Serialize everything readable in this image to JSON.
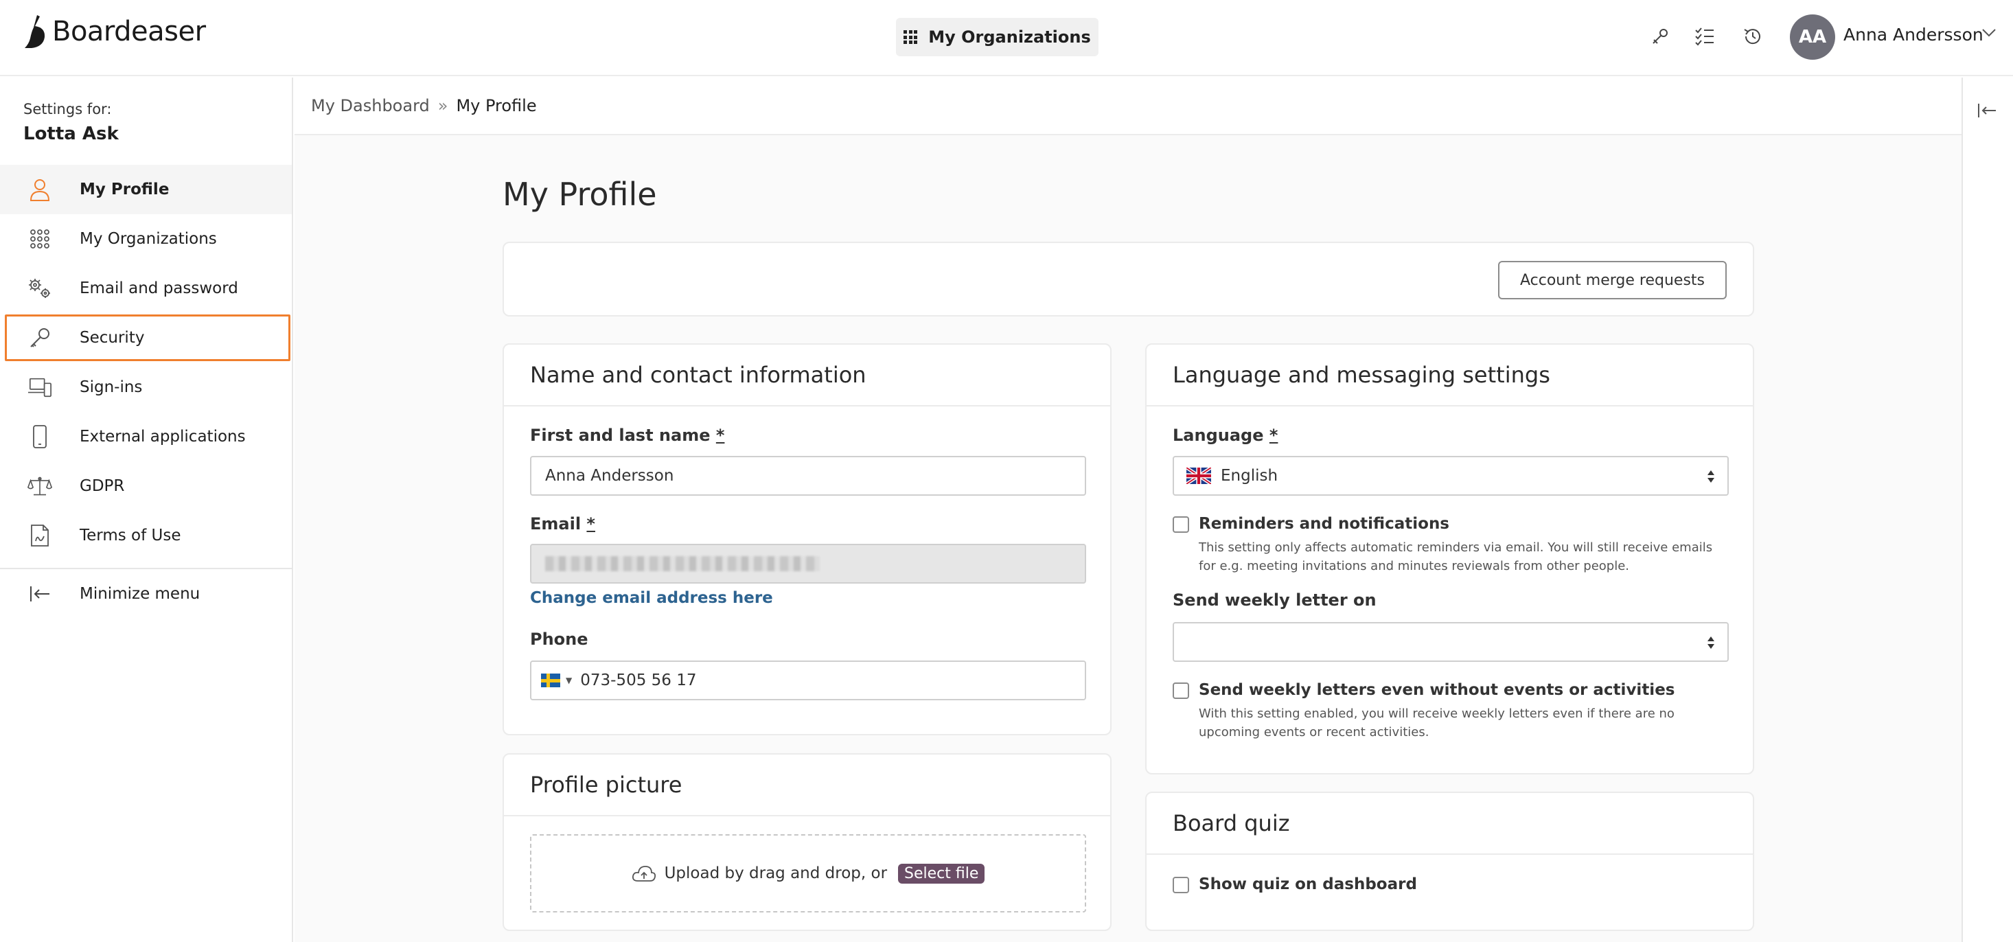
{
  "app": {
    "name": "Boardeaser"
  },
  "header": {
    "org_button": "My Organizations",
    "avatar_initials": "AA",
    "user_name": "Anna Andersson",
    "icons": [
      "key-icon",
      "checklist-icon",
      "history-icon",
      "chevron-down-icon"
    ]
  },
  "sidebar": {
    "settings_for": "Settings for:",
    "user": "Lotta Ask",
    "items": [
      {
        "label": "My Profile",
        "icon": "person-icon",
        "active": true
      },
      {
        "label": "My Organizations",
        "icon": "grid-icon"
      },
      {
        "label": "Email and password",
        "icon": "gears-icon"
      },
      {
        "label": "Security",
        "icon": "key-icon",
        "highlight": true
      },
      {
        "label": "Sign-ins",
        "icon": "devices-icon"
      },
      {
        "label": "External applications",
        "icon": "phone-icon"
      },
      {
        "label": "GDPR",
        "icon": "scales-icon"
      },
      {
        "label": "Terms of Use",
        "icon": "document-icon"
      }
    ],
    "minimize": "Minimize menu"
  },
  "breadcrumb": {
    "root": "My Dashboard",
    "separator": "»",
    "current": "My Profile"
  },
  "page": {
    "title": "My Profile",
    "merge_button": "Account merge requests"
  },
  "contact": {
    "title": "Name and contact information",
    "name_label": "First and last name",
    "required_mark": "*",
    "name_value": "Anna Andersson",
    "email_label": "Email",
    "change_email_link": "Change email address here",
    "phone_label": "Phone",
    "phone_value": "073-505 56 17"
  },
  "picture": {
    "title": "Profile picture",
    "upload_text": "Upload by drag and drop, or",
    "select_file": "Select file"
  },
  "language": {
    "title": "Language and messaging settings",
    "language_label": "Language",
    "language_value": "English",
    "reminders_title": "Reminders and notifications",
    "reminders_help": "This setting only affects automatic reminders via email. You will still receive emails for e.g. meeting invitations and minutes reviewals from other people.",
    "weekly_label": "Send weekly letter on",
    "weekly_value": "",
    "weekly_even_title": "Send weekly letters even without events or activities",
    "weekly_even_help": "With this setting enabled, you will receive weekly letters even if there are no upcoming events or recent activities."
  },
  "quiz": {
    "title": "Board quiz",
    "show_quiz": "Show quiz on dashboard"
  },
  "colors": {
    "accent": "#f07f2e",
    "link": "#2d6390",
    "select_file_bg": "#6a4d66"
  }
}
